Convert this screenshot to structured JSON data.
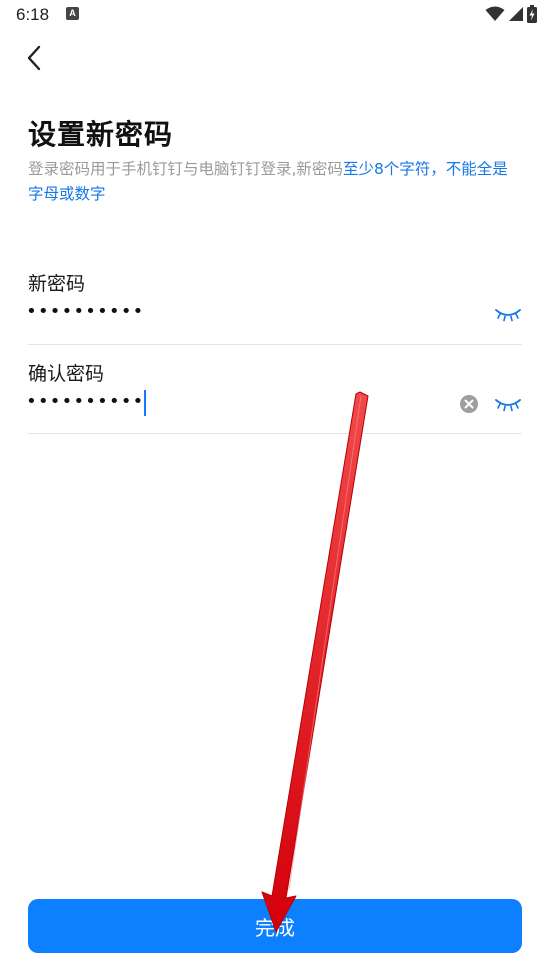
{
  "status_bar": {
    "time": "6:18",
    "notification_icon": "a-badge-icon",
    "notification_glyph": "A",
    "icons": [
      "wifi-icon",
      "signal-icon",
      "battery-charging-icon"
    ]
  },
  "nav": {
    "back_icon": "chevron-left-icon"
  },
  "page": {
    "title": "设置新密码",
    "hint_gray": "登录密码用于手机钉钉与电脑钉钉登录,新密码",
    "hint_accent": "至少8个字符，不能全是字母或数字"
  },
  "fields": {
    "new_password": {
      "label": "新密码",
      "value": "••••••••••",
      "toggle_icon": "eye-closed-icon"
    },
    "confirm_password": {
      "label": "确认密码",
      "value": "••••••••••",
      "clear_icon": "clear-icon",
      "toggle_icon": "eye-closed-icon"
    }
  },
  "actions": {
    "done_label": "完成"
  },
  "colors": {
    "accent": "#1677e5",
    "button": "#0d80ff",
    "annotation_arrow": "#e8141b",
    "hint_gray": "#9a9a9a"
  }
}
